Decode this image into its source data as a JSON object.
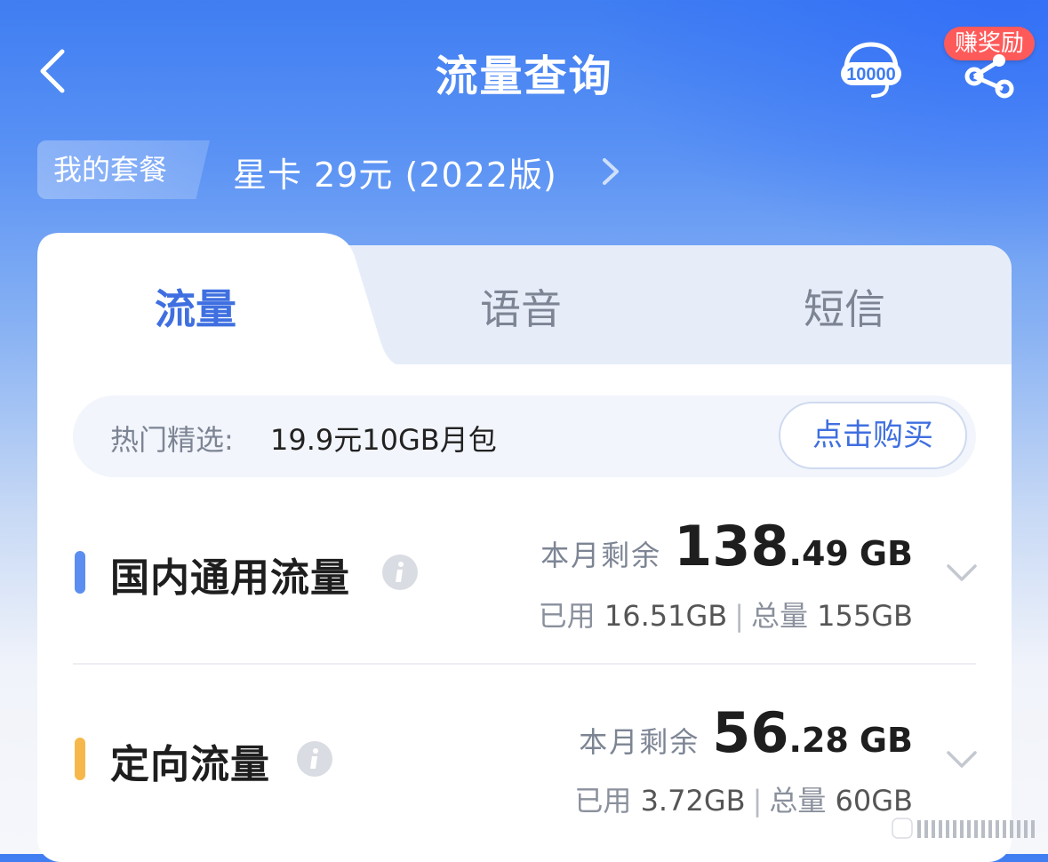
{
  "header": {
    "title": "流量查询",
    "badge": "赚奖励",
    "icons": [
      "back-chevron-icon",
      "customer-service-10000-icon",
      "share-icon"
    ]
  },
  "plan": {
    "tag": "我的套餐",
    "name": "星卡 29元 (2022版)"
  },
  "tabs": [
    {
      "label": "流量",
      "active": true
    },
    {
      "label": "语音",
      "active": false
    },
    {
      "label": "短信",
      "active": false
    }
  ],
  "promo": {
    "label": "热门精选:",
    "value": "19.9元10GB月包",
    "button": "点击购买"
  },
  "rows": [
    {
      "title": "国内通用流量",
      "color": "#5b8ef0",
      "remaining_label": "本月剩余",
      "remaining_int": "138",
      "remaining_dec": ".49",
      "unit": "GB",
      "used_label": "已用",
      "used": "16.51GB",
      "sep": "|",
      "total_label": "总量",
      "total": "155GB"
    },
    {
      "title": "定向流量",
      "color": "#f6b84b",
      "remaining_label": "本月剩余",
      "remaining_int": "56",
      "remaining_dec": ".28",
      "unit": "GB",
      "used_label": "已用",
      "used": "3.72GB",
      "sep": "|",
      "total_label": "总量",
      "total": "60GB"
    }
  ],
  "colors": {
    "accent": "#3f6fe0",
    "badge": "#ff5a5a"
  }
}
